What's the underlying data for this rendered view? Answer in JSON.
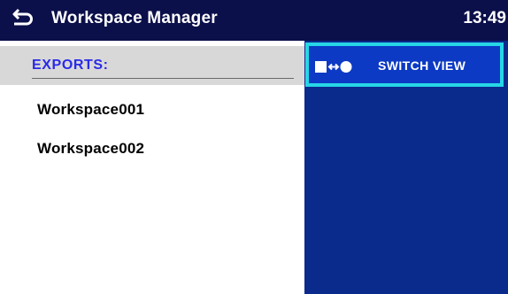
{
  "header": {
    "title": "Workspace Manager",
    "time": "13:49",
    "back_icon": "back-arrow-icon"
  },
  "left_pane": {
    "section_label": "EXPORTS:",
    "items": [
      {
        "label": "Workspace001"
      },
      {
        "label": "Workspace002"
      }
    ]
  },
  "right_pane": {
    "switch_view_label": "SWITCH VIEW",
    "switch_view_icon": "switch-view-icon"
  },
  "colors": {
    "title_bar": "#0b0f4a",
    "side_panel": "#0a2a8c",
    "button_fill": "#0c3ac4",
    "button_border": "#26d6e6",
    "section_label": "#2a2ae8",
    "section_background": "#d8d8d8"
  }
}
